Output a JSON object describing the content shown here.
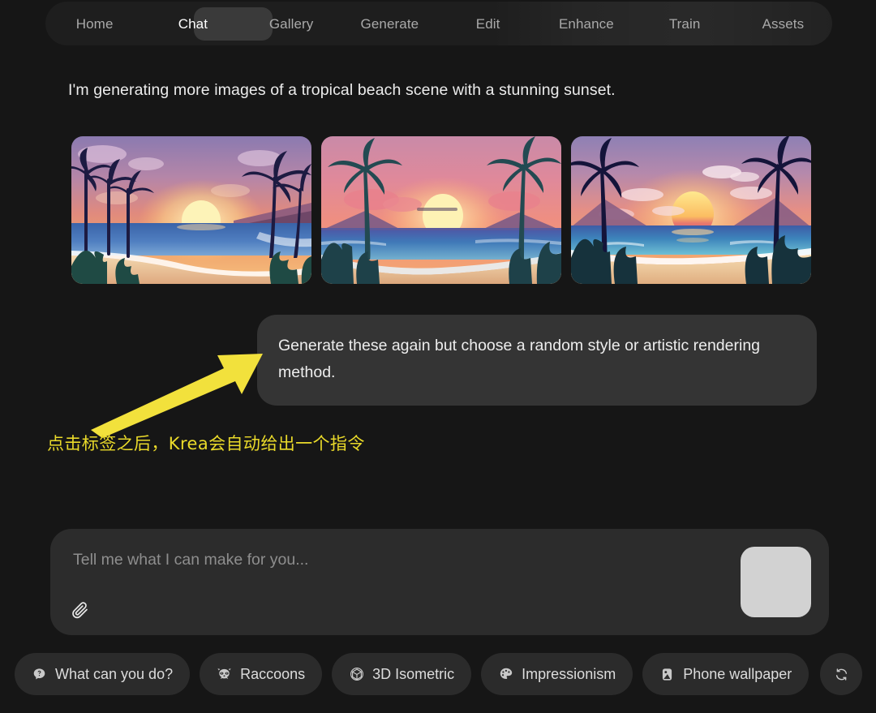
{
  "theme": {
    "background": "#161616",
    "tabbar_bg": "#1e1e1e",
    "active_pill": "#3a3a3a",
    "bubble_bg": "#343434",
    "composer_bg": "#2c2c2c",
    "chip_bg": "#2b2b2b",
    "send_button": "#d2d2d2",
    "annotation_yellow": "#eada2a",
    "text_primary": "#ececec",
    "text_muted": "#a9a9a9"
  },
  "tabs": [
    {
      "label": "Home",
      "active": false
    },
    {
      "label": "Chat",
      "active": true
    },
    {
      "label": "Gallery",
      "active": false
    },
    {
      "label": "Generate",
      "active": false
    },
    {
      "label": "Edit",
      "active": false
    },
    {
      "label": "Enhance",
      "active": false
    },
    {
      "label": "Train",
      "active": false
    },
    {
      "label": "Assets",
      "active": false
    }
  ],
  "conversation": {
    "assistant_message": "I'm generating more images of a tropical beach scene with a stunning sunset.",
    "user_message": "Generate these again but choose a random style or artistic rendering method.",
    "images": [
      {
        "alt": "tropical beach sunset with curving shoreline and palm silhouettes"
      },
      {
        "alt": "tropical beach sunset with pink sky and horizontal shoreline"
      },
      {
        "alt": "tropical beach sunset with large sun and framing palm trees"
      }
    ]
  },
  "annotation": {
    "text": "点击标签之后，Krea会自动给出一个指令",
    "arrow": "yellow-arrow-up-right"
  },
  "composer": {
    "placeholder": "Tell me what I can make for you...",
    "value": "",
    "attach_icon": "paperclip-icon",
    "send_icon": "send-button"
  },
  "suggestion_chips": [
    {
      "label": "What can you do?",
      "icon": "question-bubble-icon"
    },
    {
      "label": "Raccoons",
      "icon": "raccoon-icon"
    },
    {
      "label": "3D Isometric",
      "icon": "cube-icon"
    },
    {
      "label": "Impressionism",
      "icon": "palette-icon"
    },
    {
      "label": "Phone wallpaper",
      "icon": "phone-icon"
    }
  ],
  "refresh_button": {
    "icon": "refresh-icon",
    "label": ""
  }
}
